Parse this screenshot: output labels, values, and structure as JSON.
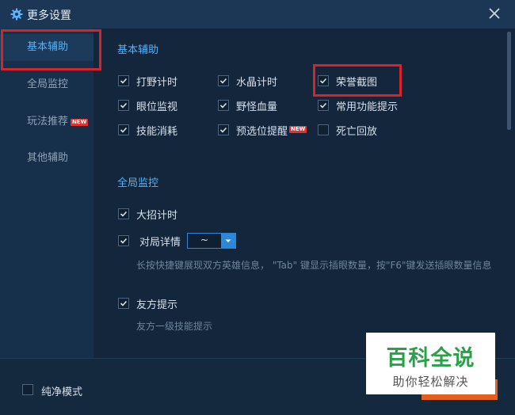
{
  "window": {
    "title": "更多设置",
    "settings_icon": "gear-icon",
    "close_icon": "close-icon"
  },
  "sidebar": {
    "items": [
      {
        "label": "基本辅助",
        "active": true
      },
      {
        "label": "全局监控"
      },
      {
        "label": "玩法推荐",
        "badge": "NEW"
      },
      {
        "label": "其他辅助"
      }
    ]
  },
  "basic": {
    "title": "基本辅助",
    "options": [
      {
        "label": "打野计时",
        "checked": true
      },
      {
        "label": "水晶计时",
        "checked": true
      },
      {
        "label": "荣誉截图",
        "checked": true
      },
      {
        "label": "眼位监视",
        "checked": true
      },
      {
        "label": "野怪血量",
        "checked": true
      },
      {
        "label": "常用功能提示",
        "checked": true
      },
      {
        "label": "技能消耗",
        "checked": true
      },
      {
        "label": "预选位提醒",
        "checked": true,
        "badge": "NEW"
      },
      {
        "label": "死亡回放",
        "checked": false
      }
    ]
  },
  "global": {
    "title": "全局监控",
    "ult_timer": {
      "label": "大招计时",
      "checked": true
    },
    "match_detail": {
      "label": "对局详情",
      "checked": true,
      "dropdown_value": "~",
      "hint": "长按快捷键展现双方英雄信息， \"Tab\" 键显示插眼数量，按\"F6\"键发送插眼数量信息"
    },
    "ally_hint": {
      "label": "友方提示",
      "checked": true,
      "hint": "友方一级技能提示"
    }
  },
  "footer": {
    "pure_mode_label": "纯净模式",
    "pure_mode_checked": false
  },
  "watermark": {
    "main": "百科全说",
    "sub": "助你轻松解决"
  },
  "colors": {
    "accent": "#4db4ff",
    "highlight": "#d8232a",
    "watermark_green": "#2aa148"
  }
}
